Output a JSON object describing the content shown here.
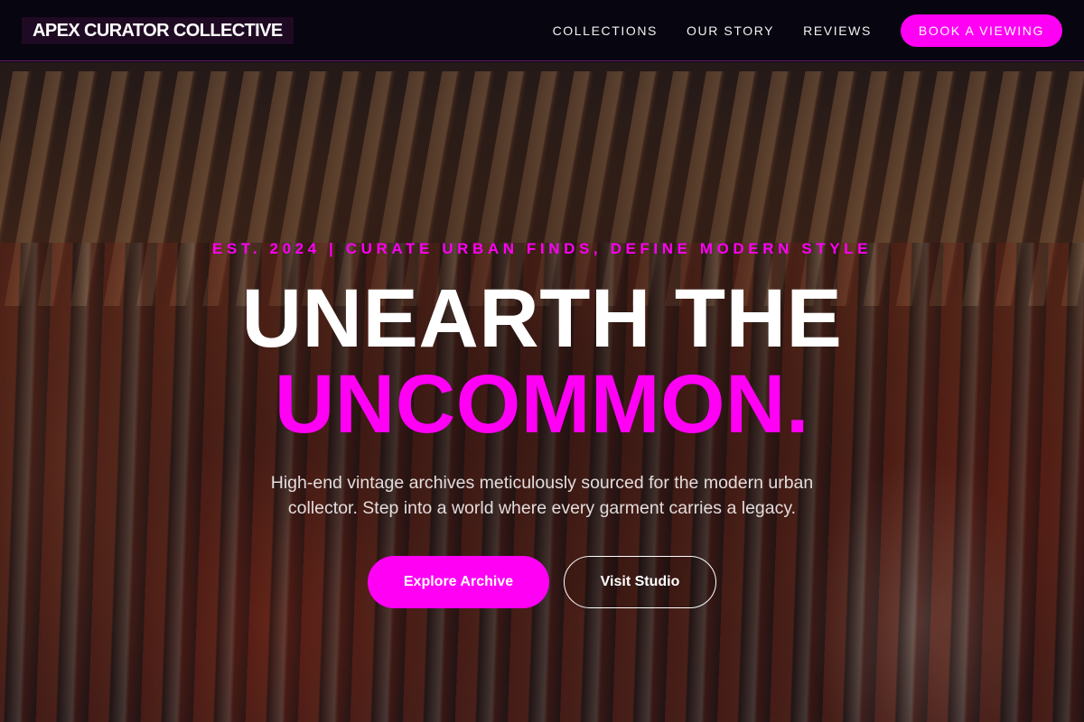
{
  "brand": {
    "name": "APEX CURATOR COLLECTIVE"
  },
  "nav": {
    "links": [
      "COLLECTIONS",
      "OUR STORY",
      "REVIEWS"
    ],
    "cta": "BOOK A VIEWING"
  },
  "hero": {
    "eyebrow": "EST. 2024 | CURATE URBAN FINDS, DEFINE MODERN STYLE",
    "title_line1": "UNEARTH THE",
    "title_line2": "UNCOMMON.",
    "subtitle": "High-end vintage archives meticulously sourced for the modern urban collector. Step into a world where every garment carries a legacy.",
    "primary_button": "Explore Archive",
    "secondary_button": "Visit Studio"
  },
  "colors": {
    "accent": "#ff00f5",
    "nav_background": "#07050f",
    "text": "#ffffff"
  }
}
